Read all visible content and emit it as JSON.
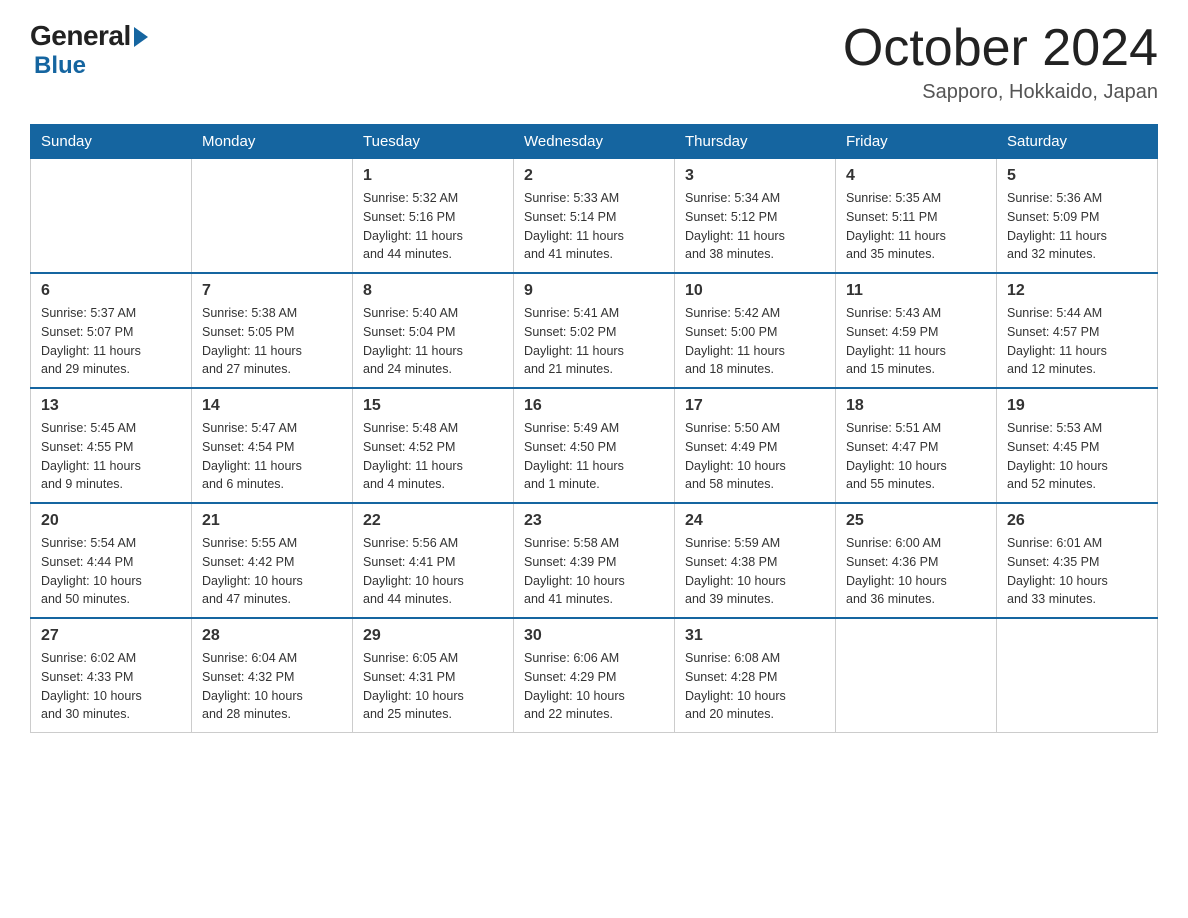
{
  "logo": {
    "general": "General",
    "blue": "Blue"
  },
  "title": "October 2024",
  "subtitle": "Sapporo, Hokkaido, Japan",
  "days_header": [
    "Sunday",
    "Monday",
    "Tuesday",
    "Wednesday",
    "Thursday",
    "Friday",
    "Saturday"
  ],
  "weeks": [
    [
      {
        "day": "",
        "info": ""
      },
      {
        "day": "",
        "info": ""
      },
      {
        "day": "1",
        "info": "Sunrise: 5:32 AM\nSunset: 5:16 PM\nDaylight: 11 hours\nand 44 minutes."
      },
      {
        "day": "2",
        "info": "Sunrise: 5:33 AM\nSunset: 5:14 PM\nDaylight: 11 hours\nand 41 minutes."
      },
      {
        "day": "3",
        "info": "Sunrise: 5:34 AM\nSunset: 5:12 PM\nDaylight: 11 hours\nand 38 minutes."
      },
      {
        "day": "4",
        "info": "Sunrise: 5:35 AM\nSunset: 5:11 PM\nDaylight: 11 hours\nand 35 minutes."
      },
      {
        "day": "5",
        "info": "Sunrise: 5:36 AM\nSunset: 5:09 PM\nDaylight: 11 hours\nand 32 minutes."
      }
    ],
    [
      {
        "day": "6",
        "info": "Sunrise: 5:37 AM\nSunset: 5:07 PM\nDaylight: 11 hours\nand 29 minutes."
      },
      {
        "day": "7",
        "info": "Sunrise: 5:38 AM\nSunset: 5:05 PM\nDaylight: 11 hours\nand 27 minutes."
      },
      {
        "day": "8",
        "info": "Sunrise: 5:40 AM\nSunset: 5:04 PM\nDaylight: 11 hours\nand 24 minutes."
      },
      {
        "day": "9",
        "info": "Sunrise: 5:41 AM\nSunset: 5:02 PM\nDaylight: 11 hours\nand 21 minutes."
      },
      {
        "day": "10",
        "info": "Sunrise: 5:42 AM\nSunset: 5:00 PM\nDaylight: 11 hours\nand 18 minutes."
      },
      {
        "day": "11",
        "info": "Sunrise: 5:43 AM\nSunset: 4:59 PM\nDaylight: 11 hours\nand 15 minutes."
      },
      {
        "day": "12",
        "info": "Sunrise: 5:44 AM\nSunset: 4:57 PM\nDaylight: 11 hours\nand 12 minutes."
      }
    ],
    [
      {
        "day": "13",
        "info": "Sunrise: 5:45 AM\nSunset: 4:55 PM\nDaylight: 11 hours\nand 9 minutes."
      },
      {
        "day": "14",
        "info": "Sunrise: 5:47 AM\nSunset: 4:54 PM\nDaylight: 11 hours\nand 6 minutes."
      },
      {
        "day": "15",
        "info": "Sunrise: 5:48 AM\nSunset: 4:52 PM\nDaylight: 11 hours\nand 4 minutes."
      },
      {
        "day": "16",
        "info": "Sunrise: 5:49 AM\nSunset: 4:50 PM\nDaylight: 11 hours\nand 1 minute."
      },
      {
        "day": "17",
        "info": "Sunrise: 5:50 AM\nSunset: 4:49 PM\nDaylight: 10 hours\nand 58 minutes."
      },
      {
        "day": "18",
        "info": "Sunrise: 5:51 AM\nSunset: 4:47 PM\nDaylight: 10 hours\nand 55 minutes."
      },
      {
        "day": "19",
        "info": "Sunrise: 5:53 AM\nSunset: 4:45 PM\nDaylight: 10 hours\nand 52 minutes."
      }
    ],
    [
      {
        "day": "20",
        "info": "Sunrise: 5:54 AM\nSunset: 4:44 PM\nDaylight: 10 hours\nand 50 minutes."
      },
      {
        "day": "21",
        "info": "Sunrise: 5:55 AM\nSunset: 4:42 PM\nDaylight: 10 hours\nand 47 minutes."
      },
      {
        "day": "22",
        "info": "Sunrise: 5:56 AM\nSunset: 4:41 PM\nDaylight: 10 hours\nand 44 minutes."
      },
      {
        "day": "23",
        "info": "Sunrise: 5:58 AM\nSunset: 4:39 PM\nDaylight: 10 hours\nand 41 minutes."
      },
      {
        "day": "24",
        "info": "Sunrise: 5:59 AM\nSunset: 4:38 PM\nDaylight: 10 hours\nand 39 minutes."
      },
      {
        "day": "25",
        "info": "Sunrise: 6:00 AM\nSunset: 4:36 PM\nDaylight: 10 hours\nand 36 minutes."
      },
      {
        "day": "26",
        "info": "Sunrise: 6:01 AM\nSunset: 4:35 PM\nDaylight: 10 hours\nand 33 minutes."
      }
    ],
    [
      {
        "day": "27",
        "info": "Sunrise: 6:02 AM\nSunset: 4:33 PM\nDaylight: 10 hours\nand 30 minutes."
      },
      {
        "day": "28",
        "info": "Sunrise: 6:04 AM\nSunset: 4:32 PM\nDaylight: 10 hours\nand 28 minutes."
      },
      {
        "day": "29",
        "info": "Sunrise: 6:05 AM\nSunset: 4:31 PM\nDaylight: 10 hours\nand 25 minutes."
      },
      {
        "day": "30",
        "info": "Sunrise: 6:06 AM\nSunset: 4:29 PM\nDaylight: 10 hours\nand 22 minutes."
      },
      {
        "day": "31",
        "info": "Sunrise: 6:08 AM\nSunset: 4:28 PM\nDaylight: 10 hours\nand 20 minutes."
      },
      {
        "day": "",
        "info": ""
      },
      {
        "day": "",
        "info": ""
      }
    ]
  ]
}
